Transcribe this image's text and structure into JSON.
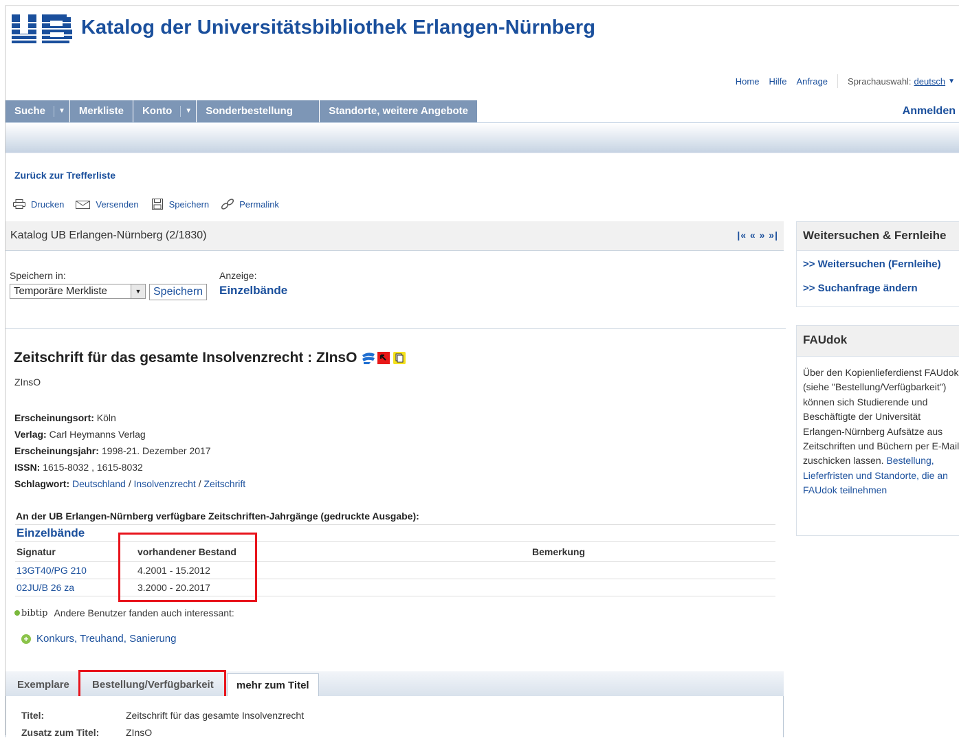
{
  "header": {
    "title": "Katalog der Universitätsbibliothek Erlangen-Nürnberg",
    "utility_links": [
      "Home",
      "Hilfe",
      "Anfrage"
    ],
    "language_label": "Sprachauswahl:",
    "language_value": "deutsch"
  },
  "nav": {
    "tabs": [
      {
        "label": "Suche"
      },
      {
        "label": "Merkliste"
      },
      {
        "label": "Konto"
      },
      {
        "label": "Sonderbestellung"
      },
      {
        "label": "Standorte, weitere Angebote"
      }
    ],
    "login": "Anmelden"
  },
  "back_link": "Zurück zur Trefferliste",
  "actions": [
    "Drucken",
    "Versenden",
    "Speichern",
    "Permalink"
  ],
  "result_bar": {
    "title": "Katalog UB Erlangen-Nürnberg (2/1830)",
    "pager": "|« « » »|"
  },
  "save": {
    "label": "Speichern in:",
    "select_value": "Temporäre Merkliste",
    "button": "Speichern",
    "view_label": "Anzeige:",
    "view_value": "Einzelbände"
  },
  "record": {
    "title": "Zeitschrift für das gesamte Insolvenzrecht : ZInsO",
    "subtitle": "ZInsO",
    "meta": {
      "place_label": "Erscheinungsort:",
      "place": "Köln",
      "publisher_label": "Verlag:",
      "publisher": "Carl Heymanns Verlag",
      "year_label": "Erscheinungsjahr:",
      "year": "1998-21. Dezember 2017",
      "issn_label": "ISSN:",
      "issn": "1615-8032 , 1615-8032",
      "subject_label": "Schlagwort:",
      "subjects": [
        "Deutschland",
        "Insolvenzrecht",
        "Zeitschrift"
      ]
    },
    "holdings_heading": "An der UB Erlangen-Nürnberg verfügbare Zeitschriften-Jahrgänge (gedruckte Ausgabe):",
    "holdings_title": "Einzelbände",
    "holdings_columns": [
      "Signatur",
      "vorhandener Bestand",
      "Bemerkung"
    ],
    "holdings_rows": [
      {
        "signatur": "13GT40/PG 210",
        "bestand": "4.2001 - 15.2012",
        "bemerkung": ""
      },
      {
        "signatur": "02JU/B 26 za",
        "bestand": "3.2000 - 20.2017",
        "bemerkung": ""
      }
    ],
    "bibtip_logo": "bibtip",
    "bibtip_text": "Andere Benutzer fanden auch interessant:",
    "recommendation": "Konkurs, Treuhand, Sanierung"
  },
  "bottom_tabs": {
    "tabs": [
      "Exemplare",
      "Bestellung/Verfügbarkeit",
      "mehr zum Titel"
    ],
    "active": "mehr zum Titel",
    "rows": [
      {
        "label": "Titel:",
        "value": "Zeitschrift für das gesamte Insolvenzrecht"
      },
      {
        "label": "Zusatz zum Titel:",
        "value": "ZInsO"
      }
    ]
  },
  "sidebar": {
    "box1": {
      "title": "Weitersuchen & Fernleihe",
      "links": [
        ">> Weitersuchen (Fernleihe)",
        ">> Suchanfrage ändern"
      ]
    },
    "box2": {
      "title": "FAUdok",
      "text": "Über den Kopienlieferdienst FAUdok (siehe \"Bestellung/Verfügbarkeit\") können sich Studierende und Beschäftigte der Universität Erlangen-Nürnberg Aufsätze aus Zeitschriften und Büchern per E-Mail zuschicken lassen.",
      "link": "Bestellung, Lieferfristen und Standorte, die an FAUdok teilnehmen"
    }
  },
  "colors": {
    "brand": "#1a4f9c",
    "nav_bg": "#7d96b6",
    "highlight_box": "#e8141c"
  }
}
